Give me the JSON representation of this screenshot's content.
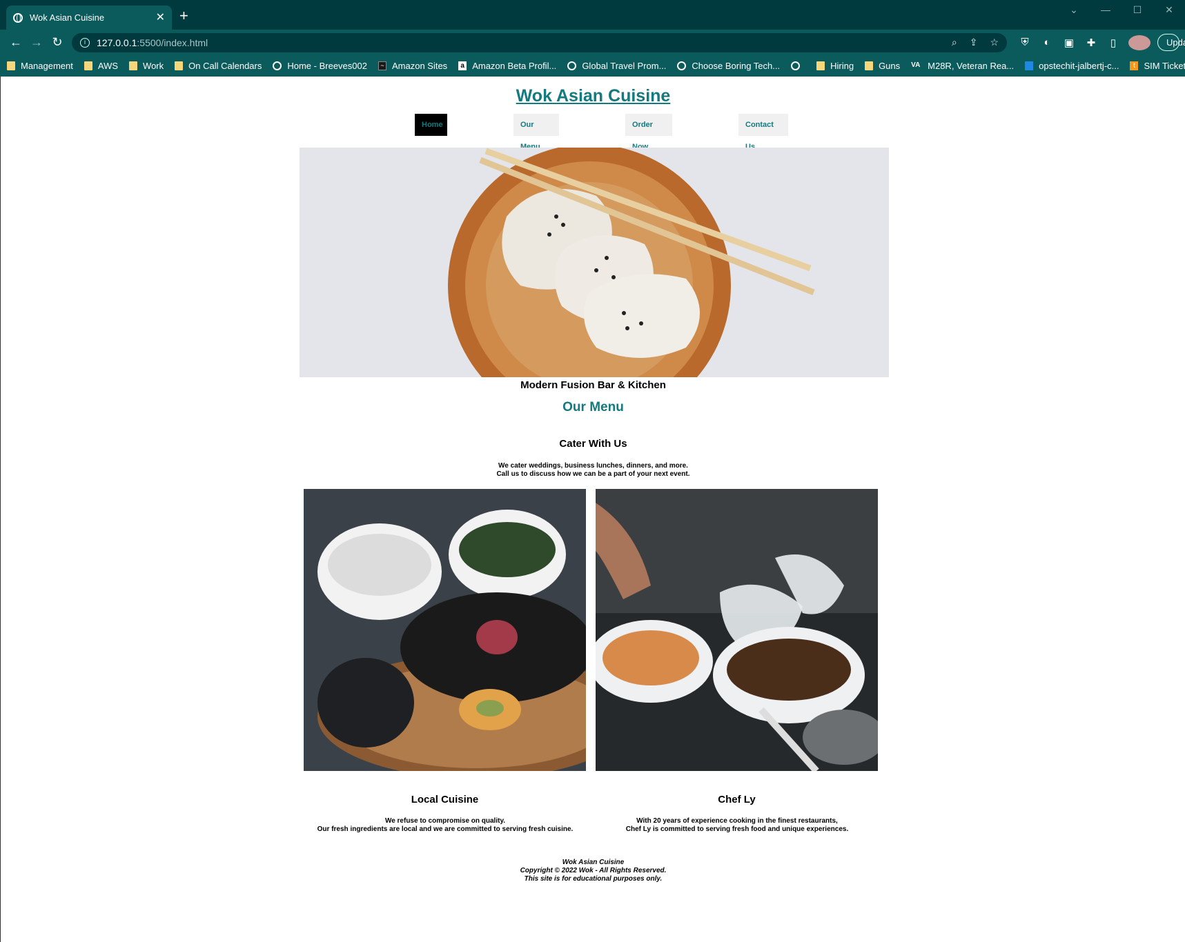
{
  "browser": {
    "tab_title": "Wok Asian Cuisine",
    "url_host": "127.0.0.1",
    "url_path": ":5500/index.html",
    "update_label": "Update",
    "bookmarks": [
      {
        "label": "Management",
        "icon": "folder-icon"
      },
      {
        "label": "AWS",
        "icon": "folder-icon"
      },
      {
        "label": "Work",
        "icon": "folder-icon"
      },
      {
        "label": "On Call Calendars",
        "icon": "folder-icon"
      },
      {
        "label": "Home - Breeves002",
        "icon": "globe-icon"
      },
      {
        "label": "Amazon Sites",
        "icon": "amazon-icon"
      },
      {
        "label": "Amazon Beta Profil...",
        "icon": "amazon-a-icon"
      },
      {
        "label": "Global Travel Prom...",
        "icon": "globe-icon"
      },
      {
        "label": "Choose Boring Tech...",
        "icon": "globe-icon"
      },
      {
        "label": "",
        "icon": "globe-icon"
      },
      {
        "label": "Hiring",
        "icon": "folder-icon"
      },
      {
        "label": "Guns",
        "icon": "folder-icon"
      },
      {
        "label": "M28R, Veteran Rea...",
        "icon": "va-icon"
      },
      {
        "label": "opstechit-jalbertj-c...",
        "icon": "chart-icon"
      },
      {
        "label": "SIM Ticketing",
        "icon": "t-icon"
      }
    ],
    "bookmarks_more": "»"
  },
  "site": {
    "title": "Wok Asian Cuisine",
    "nav": [
      "Home",
      "Our Menu",
      "Order Now",
      "Contact Us"
    ],
    "tagline": "Modern Fusion Bar & Kitchen",
    "menu_heading": "Our Menu",
    "cater": {
      "heading": "Cater With Us",
      "line1": "We cater weddings, business lunches, dinners, and more.",
      "line2": "Call us to discuss how we can be a part of your next event."
    },
    "local": {
      "heading": "Local Cuisine",
      "line1": "We refuse to compromise on quality.",
      "line2": "Our fresh ingredients are local and we are committed to serving fresh cuisine."
    },
    "chef": {
      "heading": "Chef Ly",
      "line1": "With 20 years of experience cooking in the finest restaurants,",
      "line2": "Chef Ly is committed to serving fresh food and unique experiences."
    },
    "footer": {
      "line1": "Wok Asian Cuisine",
      "line2": "Copyright © 2022 Wok - All Rights Reserved.",
      "line3": "This site is for educational purposes only."
    }
  }
}
